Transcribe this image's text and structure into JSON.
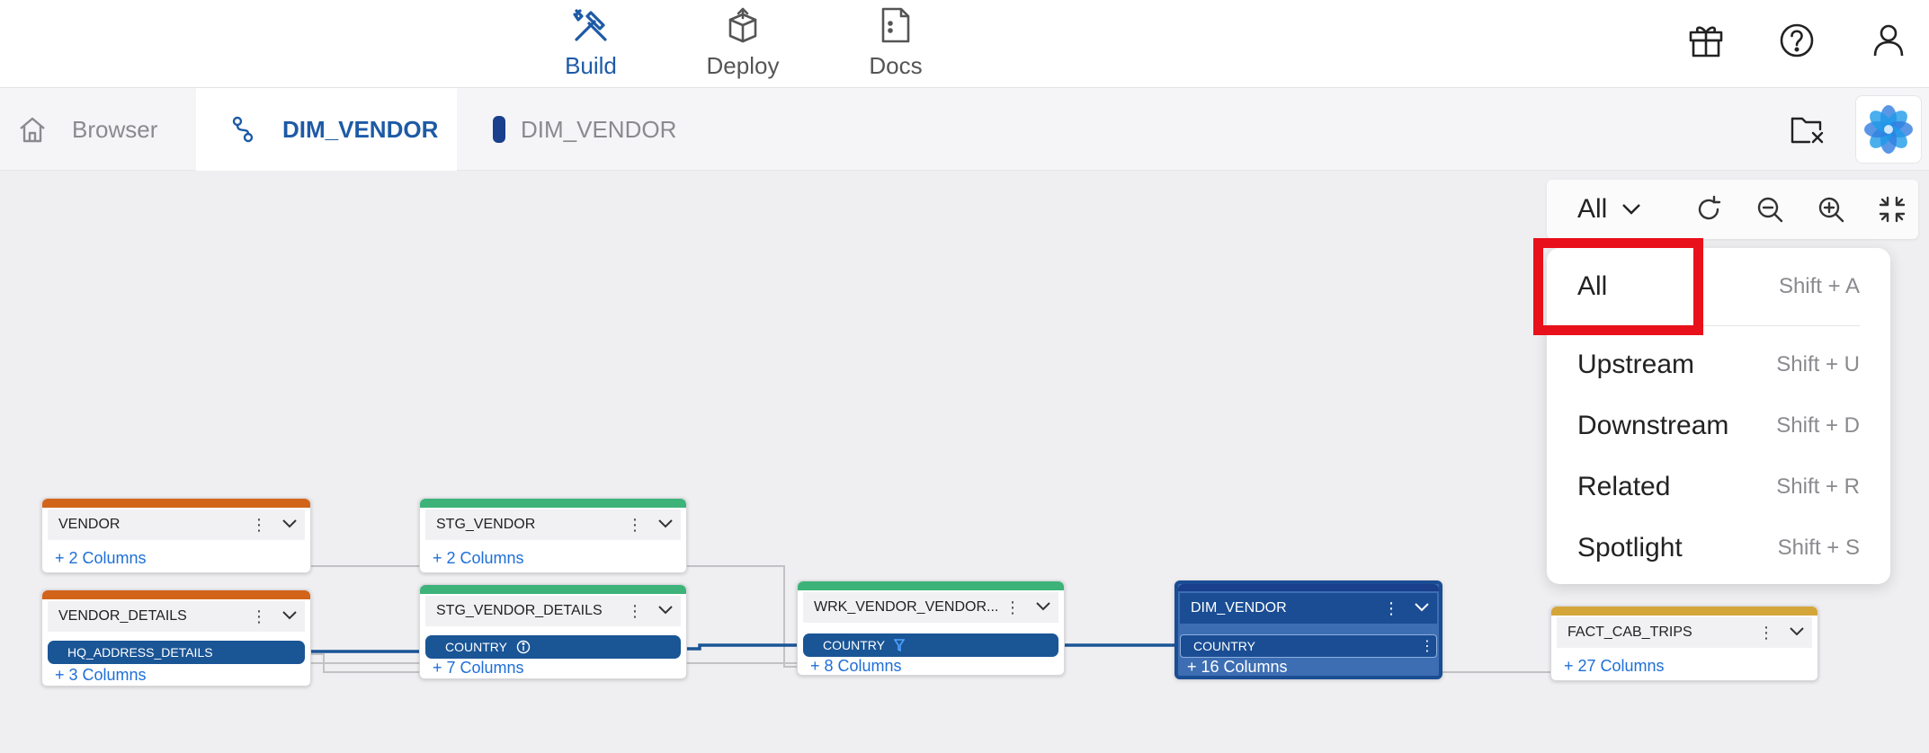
{
  "nav": {
    "tabs": [
      {
        "label": "Build",
        "icon": "hammer-wrench-icon",
        "active": true
      },
      {
        "label": "Deploy",
        "icon": "box-upload-icon",
        "active": false
      },
      {
        "label": "Docs",
        "icon": "document-icon",
        "active": false
      }
    ],
    "right_icons": [
      "gift-icon",
      "help-icon",
      "user-icon"
    ]
  },
  "tabs": [
    {
      "label": "Browser",
      "icon": "home-icon"
    },
    {
      "label": "DIM_VENDOR",
      "icon": "lineage-icon",
      "active": true
    },
    {
      "label": "DIM_VENDOR",
      "icon": "table-pill-icon"
    }
  ],
  "toolbar": {
    "filter_selected": "All",
    "icons": [
      "refresh-icon",
      "zoom-out-icon",
      "zoom-in-icon",
      "fit-screen-icon"
    ]
  },
  "menu": {
    "items": [
      {
        "label": "All",
        "shortcut": "Shift + A"
      },
      {
        "label": "Upstream",
        "shortcut": "Shift + U"
      },
      {
        "label": "Downstream",
        "shortcut": "Shift + D"
      },
      {
        "label": "Related",
        "shortcut": "Shift + R"
      },
      {
        "label": "Spotlight",
        "shortcut": "Shift + S"
      }
    ]
  },
  "colors": {
    "source": "#d2641a",
    "stage": "#3db37a",
    "dimension": "#1a3f8c",
    "fact": "#d4a63a",
    "column_pill": "#1a5596",
    "link": "#1e6fd8",
    "highlight": "#e8101a"
  },
  "nodes": [
    {
      "name": "VENDOR",
      "more": "+ 2 Columns"
    },
    {
      "name": "VENDOR_DETAILS",
      "column": "HQ_ADDRESS_DETAILS",
      "more": "+ 3 Columns"
    },
    {
      "name": "STG_VENDOR",
      "more": "+ 2 Columns"
    },
    {
      "name": "STG_VENDOR_DETAILS",
      "column": "COUNTRY",
      "more": "+ 7 Columns"
    },
    {
      "name": "WRK_VENDOR_VENDOR...",
      "column": "COUNTRY",
      "more": "+ 8 Columns"
    },
    {
      "name": "DIM_VENDOR",
      "column": "COUNTRY",
      "more": "+ 16 Columns"
    },
    {
      "name": "FACT_CAB_TRIPS",
      "more": "+ 27 Columns"
    }
  ]
}
